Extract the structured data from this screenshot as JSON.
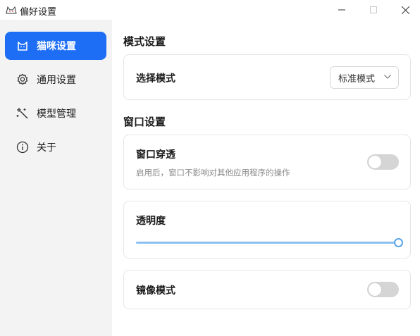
{
  "window": {
    "title": "偏好设置",
    "icon": "cat-icon"
  },
  "sidebar": {
    "items": [
      {
        "label": "猫咪设置",
        "icon": "cat-icon",
        "active": true
      },
      {
        "label": "通用设置",
        "icon": "gear-icon",
        "active": false
      },
      {
        "label": "模型管理",
        "icon": "magic-wand-icon",
        "active": false
      },
      {
        "label": "关于",
        "icon": "info-icon",
        "active": false
      }
    ]
  },
  "main": {
    "mode_section": {
      "title": "模式设置",
      "select_label": "选择模式",
      "select_value": "标准模式"
    },
    "window_section": {
      "title": "窗口设置",
      "passthrough_label": "窗口穿透",
      "passthrough_desc": "启用后，窗口不影响对其他应用程序的操作",
      "passthrough_on": false,
      "opacity_label": "透明度",
      "opacity_value": 1.0,
      "mirror_label": "镜像模式",
      "mirror_on": false
    }
  },
  "colors": {
    "accent": "#1e6ef5",
    "sidebar_bg": "#f3f3f3",
    "slider_fill": "#8cc0f0",
    "toggle_off": "#d5d5d5"
  }
}
